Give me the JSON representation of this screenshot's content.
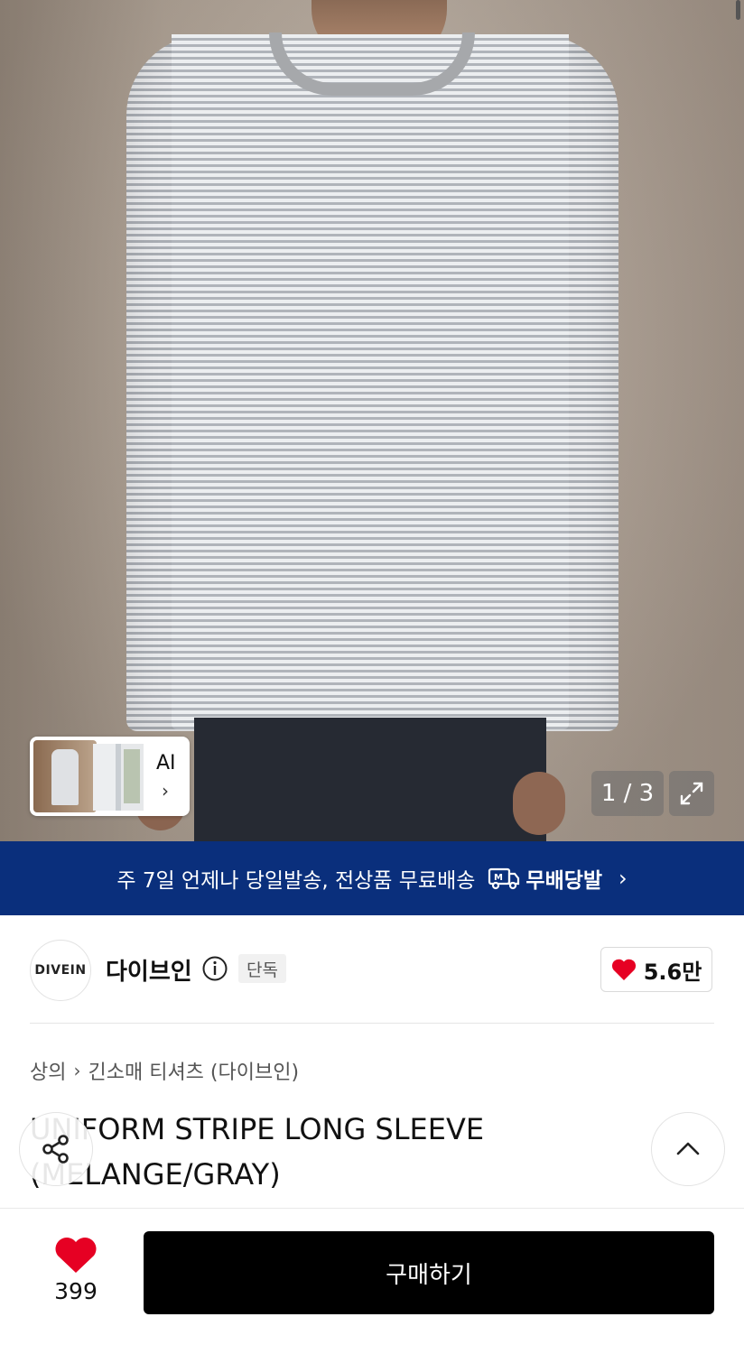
{
  "gallery": {
    "counter": "1 / 3",
    "ai_card_label": "AI",
    "ai_card_chevron": "›"
  },
  "banner": {
    "text": "주 7일 언제나 당일발송, 전상품 무료배송",
    "badge_icon": "delivery-truck-icon",
    "badge_text": "무배당발",
    "chevron": "›"
  },
  "brand": {
    "logo_text": "DIVEIN",
    "name": "다이브인",
    "tag": "단독",
    "likes": "5.6만",
    "like_color": "#e60023"
  },
  "breadcrumb": {
    "category": "상의",
    "separator": "›",
    "subcategory": "긴소매 티셔츠 (다이브인)"
  },
  "product": {
    "title": "UNIFORM STRIPE LONG SLEEVE (MELANGE/GRAY)"
  },
  "bottom_bar": {
    "wish_count": "399",
    "buy_label": "구매하기"
  },
  "colors": {
    "banner_bg": "#0a2f7c",
    "buy_bg": "#000000"
  }
}
